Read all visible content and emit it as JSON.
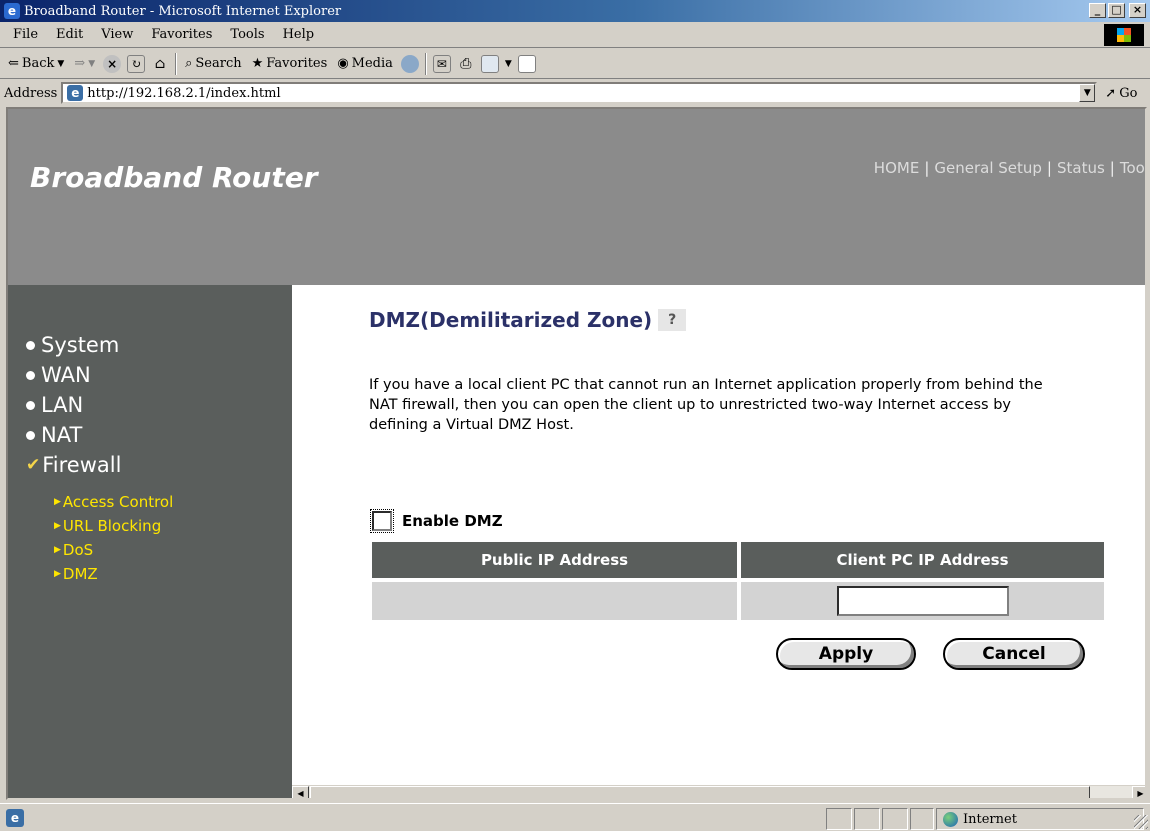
{
  "window": {
    "title": "Broadband Router - Microsoft Internet Explorer"
  },
  "menu": [
    "File",
    "Edit",
    "View",
    "Favorites",
    "Tools",
    "Help"
  ],
  "toolbar": {
    "back": "Back",
    "search": "Search",
    "favorites": "Favorites",
    "media": "Media"
  },
  "address": {
    "label": "Address",
    "url": "http://192.168.2.1/index.html",
    "go": "Go"
  },
  "banner": {
    "brand": "Broadband Router",
    "nav": [
      "HOME",
      "General Setup",
      "Status",
      "Tool"
    ]
  },
  "sidebar": {
    "items": [
      {
        "label": "System",
        "icon": "bullet-dot"
      },
      {
        "label": "WAN",
        "icon": "bullet-dot"
      },
      {
        "label": "LAN",
        "icon": "bullet-dot"
      },
      {
        "label": "NAT",
        "icon": "bullet-dot"
      },
      {
        "label": "Firewall",
        "icon": "checkmark",
        "active": true
      }
    ],
    "subitems": [
      "Access Control",
      "URL Blocking",
      "DoS",
      "DMZ"
    ]
  },
  "page": {
    "title": "DMZ(Demilitarized Zone)",
    "description": "If you have a local client PC that cannot run an Internet application properly from behind the NAT firewall, then you can open the client up to unrestricted two-way Internet access by defining a Virtual DMZ Host.",
    "enable_label": "Enable DMZ",
    "enable_checked": false,
    "table": {
      "headers": [
        "Public IP Address",
        "Client PC IP Address"
      ],
      "public_ip": "",
      "client_ip": ""
    },
    "apply_label": "Apply",
    "cancel_label": "Cancel"
  },
  "status": {
    "zone": "Internet"
  },
  "colors": {
    "banner": "#8b8b8b",
    "sidebar": "#5a5e5c",
    "submenu": "#ffe600",
    "title": "#2b3168"
  }
}
